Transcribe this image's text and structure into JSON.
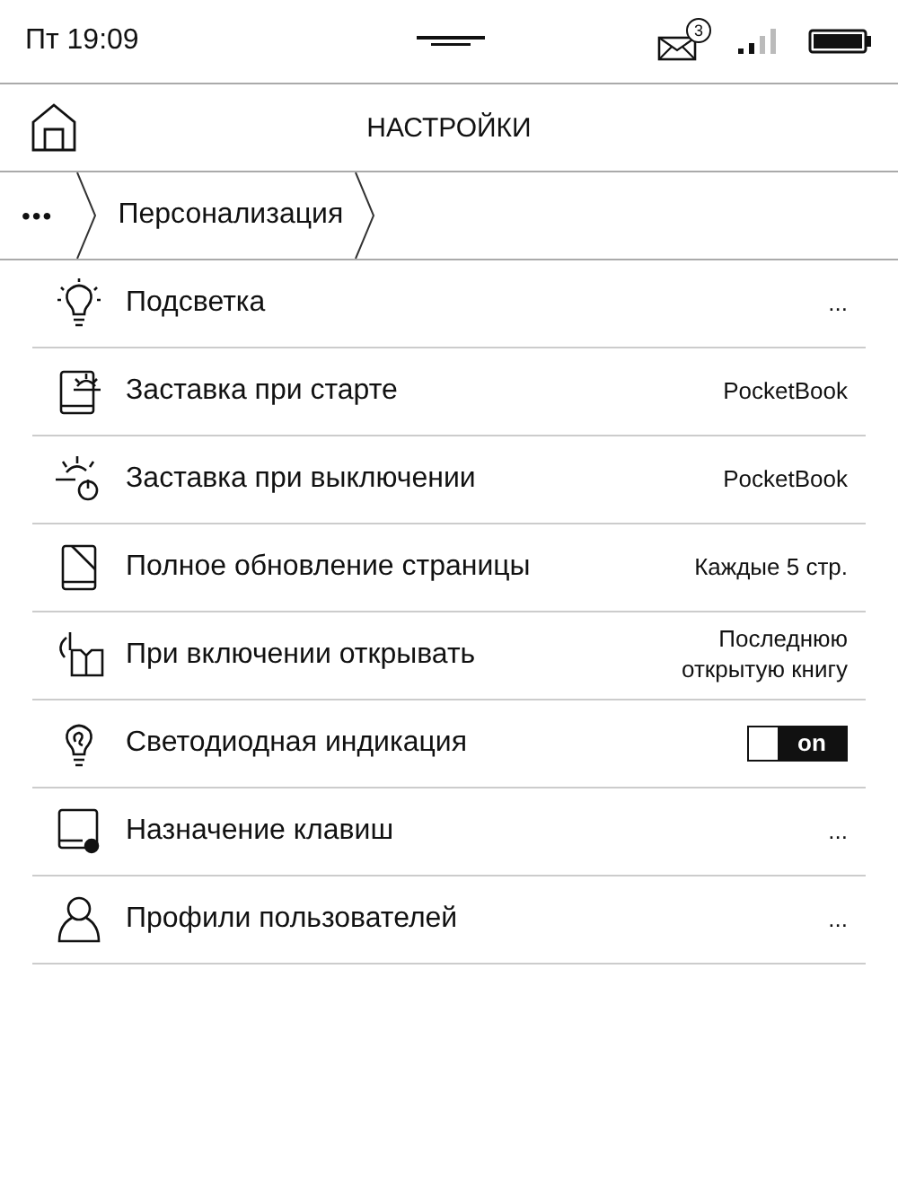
{
  "status_bar": {
    "time": "Пт 19:09",
    "mail_count": "3"
  },
  "header": {
    "title": "НАСТРОЙКИ"
  },
  "breadcrumb": {
    "more": "•••",
    "items": [
      "Персонализация"
    ]
  },
  "settings": [
    {
      "kind": "value",
      "label": "Подсветка",
      "value": "..."
    },
    {
      "kind": "value",
      "label": "Заставка при старте",
      "value": "PocketBook"
    },
    {
      "kind": "value",
      "label": "Заставка при выключении",
      "value": "PocketBook"
    },
    {
      "kind": "value",
      "label": "Полное обновление страницы",
      "value": "Каждые 5 стр."
    },
    {
      "kind": "value",
      "label": "При включении открывать",
      "value": "Последнюю открытую книгу"
    },
    {
      "kind": "toggle",
      "label": "Светодиодная индикация",
      "on": true,
      "state_label": "on"
    },
    {
      "kind": "value",
      "label": "Назначение клавиш",
      "value": "..."
    },
    {
      "kind": "value",
      "label": "Профили пользователей",
      "value": "..."
    }
  ]
}
